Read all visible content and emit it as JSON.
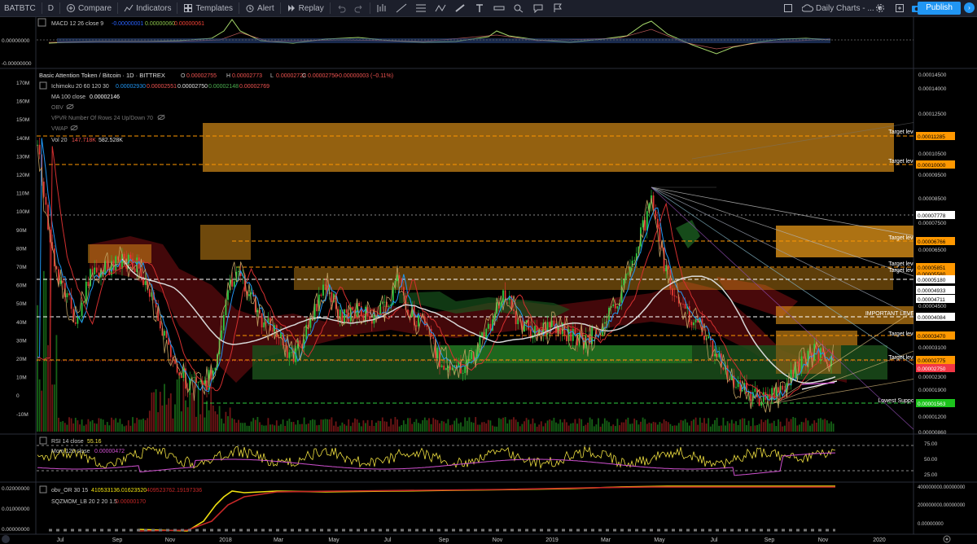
{
  "toolbar": {
    "symbol": "BATBTC",
    "interval": "D",
    "compare": "Compare",
    "indicators": "Indicators",
    "templates": "Templates",
    "alert": "Alert",
    "replay": "Replay",
    "layout": "Daily Charts - ...",
    "publish": "Publish"
  },
  "macd": {
    "label": "MACD 12 26 close 9",
    "v1": "-0.00000001",
    "v2": "0.00000060",
    "v3": "0.00000061",
    "ticks": [
      "0.00000000",
      "-0.00000000"
    ]
  },
  "main": {
    "title": "Basic Attention Token / Bitcoin · 1D · BITTREX",
    "o_lab": "O",
    "o_val": "0.00002755",
    "h_lab": "H",
    "h_val": "0.00002773",
    "l_lab": "L",
    "l_val": "0.00002723",
    "c_lab": "C",
    "c_val": "0.00002750",
    "change": "−0.00000003 (−0.11%)",
    "ichimoku_label": "Ichimoku 20 60 120 30",
    "ichi_v1": "0.00002930",
    "ichi_v2": "0.00002551",
    "ichi_v3": "0.00002750",
    "ichi_v4": "0.00002148",
    "ichi_v5": "0.00002769",
    "ma_label": "MA 100 close",
    "ma_value": "0.00002146",
    "obv_label": "OBV",
    "vpvr_label": "VPVR Number Of Rows 24 Up/Down 70",
    "vwap_label": "VWAP",
    "vol_label": "Vol 20",
    "vol_v1": "147.718K",
    "vol_v2": "582.528K"
  },
  "price_axis": {
    "ticks": [
      "0.00014500",
      "0.00014000",
      "0.00012500",
      "0.00011500",
      "0.00010500",
      "0.00009500",
      "0.00008500",
      "0.00007500",
      "0.00006500",
      "0.00004500",
      "0.00003900",
      "0.00003100",
      "0.00002300",
      "0.00001900",
      "0.00001500",
      "0.00001200",
      "0.00000860"
    ]
  },
  "price_labels": [
    {
      "text": "0.00011285",
      "color": "#ff9800"
    },
    {
      "text": "0.00010000",
      "color": "#ff9800"
    },
    {
      "text": "0.00007778",
      "color": "#000000"
    },
    {
      "text": "0.00006766",
      "color": "#ff9800"
    },
    {
      "text": "0.00005851",
      "color": "#ff9800"
    },
    {
      "text": "0.00005580",
      "color": "#ff9800"
    },
    {
      "text": "0.00005180",
      "color": "#000000"
    },
    {
      "text": "0.00004933",
      "color": "#000000"
    },
    {
      "text": "0.00004711",
      "color": "#000000"
    },
    {
      "text": "0.00004084",
      "color": "#000000"
    },
    {
      "text": "0.00003470",
      "color": "#ff9800"
    },
    {
      "text": "0.00002775",
      "color": "#ff9800"
    },
    {
      "text": "0.00002750",
      "color": "#f23645"
    },
    {
      "text": "0.00001563",
      "color": "#1cc41c"
    }
  ],
  "annotations": {
    "target_level": "Target level",
    "important_level": "IMPORTANT LEVEL",
    "lowest_support": "Lowest Support"
  },
  "volume_axis": {
    "ticks": [
      "170M",
      "160M",
      "150M",
      "140M",
      "130M",
      "120M",
      "110M",
      "100M",
      "90M",
      "80M",
      "70M",
      "60M",
      "50M",
      "40M",
      "30M",
      "20M",
      "10M",
      "0",
      "-10M"
    ]
  },
  "rsi": {
    "label": "RSI 14 close",
    "value": "55.16",
    "mom_label": "Mom 120 close",
    "mom_value": "0.00000472",
    "ticks": [
      "75.00",
      "50.00",
      "25.00"
    ]
  },
  "obv_osc": {
    "label": "obv_OR 30 15",
    "v1": "410533136.01623520",
    "v2": "409523762.19197336",
    "sqz_label": "SQZMOM_LB 20 2 20 1.5",
    "sqz_value": "0.00000170",
    "left_ticks": [
      "0.02000000",
      "0.01000000",
      "0.00000000"
    ],
    "right_ticks": [
      "400000000.00000000",
      "200000000.00000000",
      "0.00000000"
    ]
  },
  "time_axis": {
    "labels": [
      "Jul",
      "Sep",
      "Nov",
      "2018",
      "Mar",
      "May",
      "Jul",
      "Sep",
      "Nov",
      "2019",
      "Mar",
      "May",
      "Jul",
      "Sep",
      "Nov",
      "2020"
    ]
  },
  "colors": {
    "up": "#26a69a",
    "down": "#ef5350",
    "target_box": "#f7a21b",
    "accent": "#2196f3"
  }
}
